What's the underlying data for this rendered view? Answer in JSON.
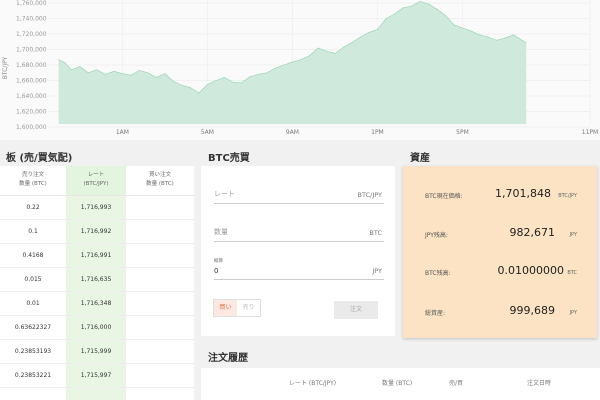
{
  "chart_data": {
    "type": "area",
    "ylabel": "BTC/JPY",
    "ylim": [
      1600000,
      1760000
    ],
    "y_ticks": [
      "1,600,000",
      "1,620,000",
      "1,640,000",
      "1,660,000",
      "1,680,000",
      "1,700,000",
      "1,720,000",
      "1,740,000",
      "1,760,000"
    ],
    "x_ticks": [
      "1AM",
      "5AM",
      "9AM",
      "1PM",
      "5PM",
      "11PM"
    ],
    "x_tick_hours": [
      1,
      5,
      9,
      13,
      17,
      23
    ],
    "xlim_hours": [
      -2.5,
      23
    ],
    "grid": true,
    "color": "#cfeadc",
    "series": [
      {
        "x": [
          -2,
          -1.7,
          -1.4,
          -1,
          -0.6,
          -0.2,
          0.2,
          0.6,
          1,
          1.4,
          1.8,
          2.2,
          2.6,
          3,
          3.4,
          3.8,
          4.2,
          4.6,
          5,
          5.4,
          5.8,
          6.2,
          6.6,
          7,
          7.4,
          7.8,
          8.2,
          8.6,
          9,
          9.4,
          9.8,
          10.2,
          10.6,
          11,
          11.4,
          11.8,
          12.2,
          12.6,
          13,
          13.4,
          13.8,
          14.2,
          14.6,
          15,
          15.4,
          15.8,
          16.2,
          16.6,
          17,
          17.4,
          17.8,
          18.2,
          18.6,
          19,
          19.4,
          19.8,
          20
        ],
        "y": [
          1683000,
          1679000,
          1670000,
          1674000,
          1666000,
          1670000,
          1664000,
          1668000,
          1665000,
          1663000,
          1669000,
          1666000,
          1660000,
          1665000,
          1655000,
          1650000,
          1647000,
          1640000,
          1651000,
          1656000,
          1660000,
          1654000,
          1653000,
          1661000,
          1664000,
          1666000,
          1672000,
          1676000,
          1680000,
          1683000,
          1688000,
          1698000,
          1694000,
          1691000,
          1699000,
          1705000,
          1712000,
          1718000,
          1722000,
          1736000,
          1742000,
          1750000,
          1752000,
          1758000,
          1755000,
          1748000,
          1740000,
          1728000,
          1724000,
          1720000,
          1715000,
          1712000,
          1708000,
          1711000,
          1715000,
          1708000,
          1705000
        ]
      }
    ]
  },
  "orderbook": {
    "title": "板 (売/買気配)",
    "headers": {
      "sell": [
        "売り注文",
        "数量 (BTC)"
      ],
      "rate": [
        "レート",
        "(BTC/JPY)"
      ],
      "buy": [
        "買い注文",
        "数量 (BTC)"
      ]
    },
    "rows": [
      {
        "sell": "0.22",
        "rate": "1,716,993",
        "buy": ""
      },
      {
        "sell": "0.1",
        "rate": "1,716,992",
        "buy": ""
      },
      {
        "sell": "0.4168",
        "rate": "1,716,991",
        "buy": ""
      },
      {
        "sell": "0.015",
        "rate": "1,716,635",
        "buy": ""
      },
      {
        "sell": "0.01",
        "rate": "1,716,348",
        "buy": ""
      },
      {
        "sell": "0.63622327",
        "rate": "1,716,000",
        "buy": ""
      },
      {
        "sell": "0.23853193",
        "rate": "1,715,999",
        "buy": ""
      },
      {
        "sell": "0.23853221",
        "rate": "1,715,997",
        "buy": ""
      },
      {
        "sell": "",
        "rate": "",
        "buy": ""
      }
    ]
  },
  "trade": {
    "title": "BTC売買",
    "rate_placeholder": "レート",
    "rate_unit": "BTC/JPY",
    "amount_placeholder": "数量",
    "amount_unit": "BTC",
    "total_label": "概算",
    "total_value": "0",
    "total_unit": "JPY",
    "buy_label": "買い",
    "sell_label": "売り",
    "submit_label": "注文"
  },
  "assets": {
    "title": "資産",
    "rows": [
      {
        "label": "BTC現在価格:",
        "value": "1,701,848",
        "unit": "BTC/JPY"
      },
      {
        "label": "JPY残高:",
        "value": "982,671",
        "unit": "JPY"
      },
      {
        "label": "BTC残高:",
        "value": "0.01000000",
        "unit": "BTC"
      },
      {
        "label": "総資産:",
        "value": "999,689",
        "unit": "JPY"
      }
    ]
  },
  "history": {
    "title": "注文履歴",
    "headers": [
      "レート (BTC/JPY)",
      "数量 (BTC)",
      "売/買",
      "注文日時"
    ]
  }
}
